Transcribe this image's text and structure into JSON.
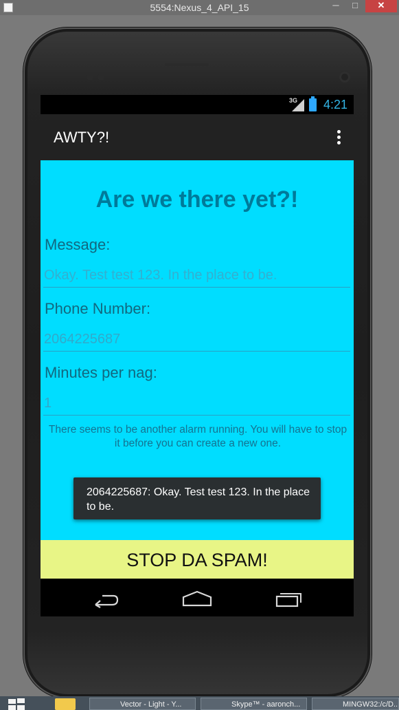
{
  "window": {
    "title": "5554:Nexus_4_API_15",
    "min_label": "─",
    "max_label": "□",
    "close_label": "✕"
  },
  "status_bar": {
    "network": "3G",
    "time": "4:21"
  },
  "action_bar": {
    "title": "AWTY?!"
  },
  "form": {
    "heading": "Are we there yet?!",
    "message_label": "Message:",
    "message_value": "Okay. Test test 123. In the place to be.",
    "phone_label": "Phone Number:",
    "phone_value": "2064225687",
    "minutes_label": "Minutes per nag:",
    "minutes_value": "1",
    "warning": "There seems to be another alarm running. You will have to stop it before you can create a new one."
  },
  "toast": {
    "text": "2064225687: Okay. Test test 123. In the place to be."
  },
  "button": {
    "stop_label": "STOP DA SPAM!"
  },
  "taskbar": {
    "items": [
      {
        "label": "Vector - Light - Y..."
      },
      {
        "label": "Skype™ - aaronch..."
      },
      {
        "label": "MINGW32:/c/D..."
      }
    ]
  },
  "colors": {
    "content_bg": "#00ddff",
    "heading": "#007a9a",
    "button_bg": "#e8f586",
    "clock": "#33b5e5"
  },
  "icons": {
    "nav_back": "back-icon",
    "nav_home": "home-icon",
    "nav_recent": "recent-apps-icon",
    "overflow": "overflow-menu-icon"
  }
}
